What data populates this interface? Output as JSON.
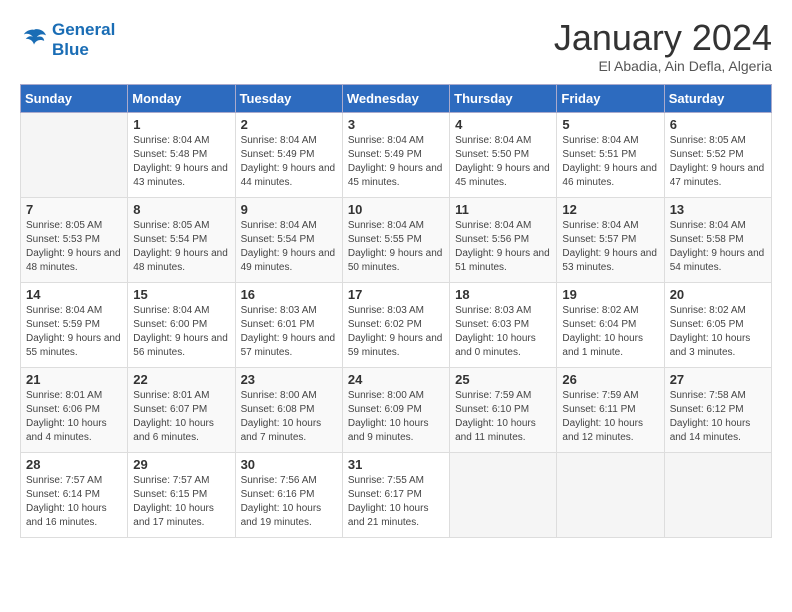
{
  "header": {
    "logo_line1": "General",
    "logo_line2": "Blue",
    "month": "January 2024",
    "location": "El Abadia, Ain Defla, Algeria"
  },
  "days_of_week": [
    "Sunday",
    "Monday",
    "Tuesday",
    "Wednesday",
    "Thursday",
    "Friday",
    "Saturday"
  ],
  "weeks": [
    [
      {
        "day": "",
        "sunrise": "",
        "sunset": "",
        "daylight": ""
      },
      {
        "day": "1",
        "sunrise": "Sunrise: 8:04 AM",
        "sunset": "Sunset: 5:48 PM",
        "daylight": "Daylight: 9 hours and 43 minutes."
      },
      {
        "day": "2",
        "sunrise": "Sunrise: 8:04 AM",
        "sunset": "Sunset: 5:49 PM",
        "daylight": "Daylight: 9 hours and 44 minutes."
      },
      {
        "day": "3",
        "sunrise": "Sunrise: 8:04 AM",
        "sunset": "Sunset: 5:49 PM",
        "daylight": "Daylight: 9 hours and 45 minutes."
      },
      {
        "day": "4",
        "sunrise": "Sunrise: 8:04 AM",
        "sunset": "Sunset: 5:50 PM",
        "daylight": "Daylight: 9 hours and 45 minutes."
      },
      {
        "day": "5",
        "sunrise": "Sunrise: 8:04 AM",
        "sunset": "Sunset: 5:51 PM",
        "daylight": "Daylight: 9 hours and 46 minutes."
      },
      {
        "day": "6",
        "sunrise": "Sunrise: 8:05 AM",
        "sunset": "Sunset: 5:52 PM",
        "daylight": "Daylight: 9 hours and 47 minutes."
      }
    ],
    [
      {
        "day": "7",
        "sunrise": "Sunrise: 8:05 AM",
        "sunset": "Sunset: 5:53 PM",
        "daylight": "Daylight: 9 hours and 48 minutes."
      },
      {
        "day": "8",
        "sunrise": "Sunrise: 8:05 AM",
        "sunset": "Sunset: 5:54 PM",
        "daylight": "Daylight: 9 hours and 48 minutes."
      },
      {
        "day": "9",
        "sunrise": "Sunrise: 8:04 AM",
        "sunset": "Sunset: 5:54 PM",
        "daylight": "Daylight: 9 hours and 49 minutes."
      },
      {
        "day": "10",
        "sunrise": "Sunrise: 8:04 AM",
        "sunset": "Sunset: 5:55 PM",
        "daylight": "Daylight: 9 hours and 50 minutes."
      },
      {
        "day": "11",
        "sunrise": "Sunrise: 8:04 AM",
        "sunset": "Sunset: 5:56 PM",
        "daylight": "Daylight: 9 hours and 51 minutes."
      },
      {
        "day": "12",
        "sunrise": "Sunrise: 8:04 AM",
        "sunset": "Sunset: 5:57 PM",
        "daylight": "Daylight: 9 hours and 53 minutes."
      },
      {
        "day": "13",
        "sunrise": "Sunrise: 8:04 AM",
        "sunset": "Sunset: 5:58 PM",
        "daylight": "Daylight: 9 hours and 54 minutes."
      }
    ],
    [
      {
        "day": "14",
        "sunrise": "Sunrise: 8:04 AM",
        "sunset": "Sunset: 5:59 PM",
        "daylight": "Daylight: 9 hours and 55 minutes."
      },
      {
        "day": "15",
        "sunrise": "Sunrise: 8:04 AM",
        "sunset": "Sunset: 6:00 PM",
        "daylight": "Daylight: 9 hours and 56 minutes."
      },
      {
        "day": "16",
        "sunrise": "Sunrise: 8:03 AM",
        "sunset": "Sunset: 6:01 PM",
        "daylight": "Daylight: 9 hours and 57 minutes."
      },
      {
        "day": "17",
        "sunrise": "Sunrise: 8:03 AM",
        "sunset": "Sunset: 6:02 PM",
        "daylight": "Daylight: 9 hours and 59 minutes."
      },
      {
        "day": "18",
        "sunrise": "Sunrise: 8:03 AM",
        "sunset": "Sunset: 6:03 PM",
        "daylight": "Daylight: 10 hours and 0 minutes."
      },
      {
        "day": "19",
        "sunrise": "Sunrise: 8:02 AM",
        "sunset": "Sunset: 6:04 PM",
        "daylight": "Daylight: 10 hours and 1 minute."
      },
      {
        "day": "20",
        "sunrise": "Sunrise: 8:02 AM",
        "sunset": "Sunset: 6:05 PM",
        "daylight": "Daylight: 10 hours and 3 minutes."
      }
    ],
    [
      {
        "day": "21",
        "sunrise": "Sunrise: 8:01 AM",
        "sunset": "Sunset: 6:06 PM",
        "daylight": "Daylight: 10 hours and 4 minutes."
      },
      {
        "day": "22",
        "sunrise": "Sunrise: 8:01 AM",
        "sunset": "Sunset: 6:07 PM",
        "daylight": "Daylight: 10 hours and 6 minutes."
      },
      {
        "day": "23",
        "sunrise": "Sunrise: 8:00 AM",
        "sunset": "Sunset: 6:08 PM",
        "daylight": "Daylight: 10 hours and 7 minutes."
      },
      {
        "day": "24",
        "sunrise": "Sunrise: 8:00 AM",
        "sunset": "Sunset: 6:09 PM",
        "daylight": "Daylight: 10 hours and 9 minutes."
      },
      {
        "day": "25",
        "sunrise": "Sunrise: 7:59 AM",
        "sunset": "Sunset: 6:10 PM",
        "daylight": "Daylight: 10 hours and 11 minutes."
      },
      {
        "day": "26",
        "sunrise": "Sunrise: 7:59 AM",
        "sunset": "Sunset: 6:11 PM",
        "daylight": "Daylight: 10 hours and 12 minutes."
      },
      {
        "day": "27",
        "sunrise": "Sunrise: 7:58 AM",
        "sunset": "Sunset: 6:12 PM",
        "daylight": "Daylight: 10 hours and 14 minutes."
      }
    ],
    [
      {
        "day": "28",
        "sunrise": "Sunrise: 7:57 AM",
        "sunset": "Sunset: 6:14 PM",
        "daylight": "Daylight: 10 hours and 16 minutes."
      },
      {
        "day": "29",
        "sunrise": "Sunrise: 7:57 AM",
        "sunset": "Sunset: 6:15 PM",
        "daylight": "Daylight: 10 hours and 17 minutes."
      },
      {
        "day": "30",
        "sunrise": "Sunrise: 7:56 AM",
        "sunset": "Sunset: 6:16 PM",
        "daylight": "Daylight: 10 hours and 19 minutes."
      },
      {
        "day": "31",
        "sunrise": "Sunrise: 7:55 AM",
        "sunset": "Sunset: 6:17 PM",
        "daylight": "Daylight: 10 hours and 21 minutes."
      },
      {
        "day": "",
        "sunrise": "",
        "sunset": "",
        "daylight": ""
      },
      {
        "day": "",
        "sunrise": "",
        "sunset": "",
        "daylight": ""
      },
      {
        "day": "",
        "sunrise": "",
        "sunset": "",
        "daylight": ""
      }
    ]
  ]
}
